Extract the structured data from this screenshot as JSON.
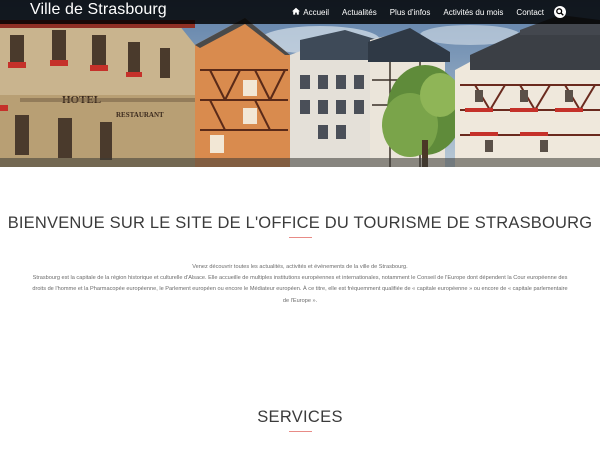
{
  "site": {
    "brand": "Ville de Strasbourg"
  },
  "nav": {
    "items": [
      {
        "label": "Accueil",
        "icon": "home-icon"
      },
      {
        "label": "Actualités"
      },
      {
        "label": "Plus d'infos"
      },
      {
        "label": "Activités du mois"
      },
      {
        "label": "Contact"
      }
    ],
    "search_icon": "search-icon"
  },
  "hero": {
    "image": "strasbourg-half-timbered-houses-photo",
    "sign_hotel": "HOTEL",
    "sign_restaurant": "RESTAURANT"
  },
  "welcome": {
    "title": "BIENVENUE SUR LE SITE DE L'OFFICE DU TOURISME DE STRASBOURG",
    "line1": "Venez découvrir toutes les actualités, activités et événements de la ville de Strasbourg.",
    "line2": "Strasbourg est la capitale de la région historique et culturelle d'Alsace. Elle accueille de multiples institutions européennes et internationales, notamment le Conseil de l'Europe dont dépendent la Cour européenne des droits de l'homme et la Pharmacopée européenne, le Parlement européen ou encore le Médiateur européen. À ce titre, elle est fréquemment qualifiée de « capitale européenne » ou encore de « capitale parlementaire de l'Europe »."
  },
  "services": {
    "title": "SERVICES"
  },
  "colors": {
    "accent_line": "#e88b86",
    "navbar": "#000000",
    "text_dark": "#3b3b3b"
  }
}
